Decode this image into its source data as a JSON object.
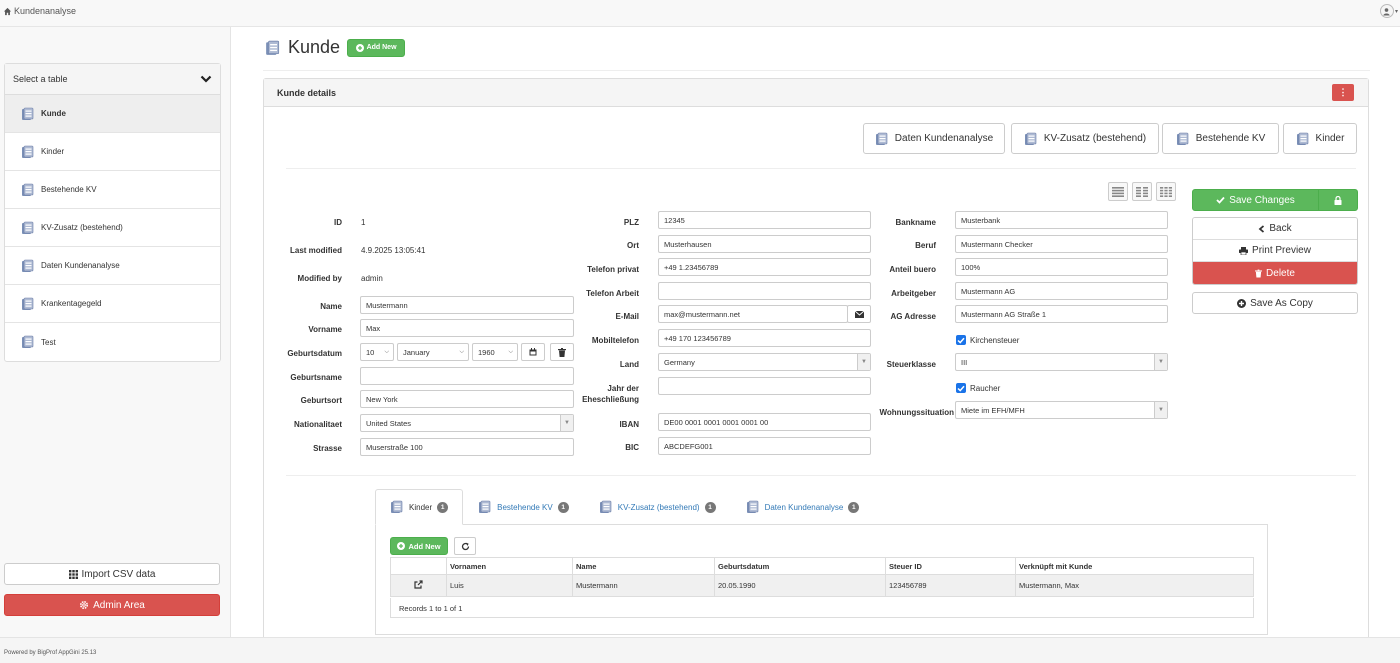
{
  "app": {
    "title": "Kundenanalyse"
  },
  "sidebar": {
    "select_label": "Select a table",
    "tables": [
      {
        "label": "Kunde",
        "active": true
      },
      {
        "label": "Kinder",
        "active": false
      },
      {
        "label": "Bestehende KV",
        "active": false
      },
      {
        "label": "KV-Zusatz (bestehend)",
        "active": false
      },
      {
        "label": "Daten Kundenanalyse",
        "active": false
      },
      {
        "label": "Krankentagegeld",
        "active": false
      },
      {
        "label": "Test",
        "active": false
      }
    ],
    "import_csv_label": "Import CSV data",
    "admin_label": "Admin Area"
  },
  "footer": {
    "text": "Powered by BigProf AppGini 25.13"
  },
  "page": {
    "title": "Kunde",
    "add_new_label": "Add New"
  },
  "details": {
    "title": "Kunde details",
    "kebab": "⋮",
    "link_buttons": [
      "Daten Kundenanalyse",
      "KV-Zusatz (bestehend)",
      "Bestehende KV",
      "Kinder"
    ]
  },
  "form": {
    "col1": {
      "id_label": "ID",
      "id_value": "1",
      "last_modified_label": "Last modified",
      "last_modified_value": "4.9.2025 13:05:41",
      "modified_by_label": "Modified by",
      "modified_by_value": "admin",
      "name_label": "Name",
      "name_value": "Mustermann",
      "vorname_label": "Vorname",
      "vorname_value": "Max",
      "geburtsdatum_label": "Geburtsdatum",
      "geburtsdatum_day": "10",
      "geburtsdatum_month": "January",
      "geburtsdatum_year": "1960",
      "geburtsname_label": "Geburtsname",
      "geburtsname_value": "",
      "geburtsort_label": "Geburtsort",
      "geburtsort_value": "New York",
      "nationalitaet_label": "Nationalitaet",
      "nationalitaet_value": "United States",
      "strasse_label": "Strasse",
      "strasse_value": "Muserstraße 100"
    },
    "col2": {
      "plz_label": "PLZ",
      "plz_value": "12345",
      "ort_label": "Ort",
      "ort_value": "Musterhausen",
      "telefon_privat_label": "Telefon privat",
      "telefon_privat_value": "+49 1.23456789",
      "telefon_arbeit_label": "Telefon Arbeit",
      "telefon_arbeit_value": "",
      "email_label": "E-Mail",
      "email_value": "max@mustermann.net",
      "mobiltelefon_label": "Mobiltelefon",
      "mobiltelefon_value": "+49 170 123456789",
      "land_label": "Land",
      "land_value": "Germany",
      "eheschliessung_label_1": "Jahr der",
      "eheschliessung_label_2": "Eheschließung",
      "eheschliessung_value": "",
      "iban_label": "IBAN",
      "iban_value": "DE00 0001 0001 0001 0001 00",
      "bic_label": "BIC",
      "bic_value": "ABCDEFG001"
    },
    "col3": {
      "bankname_label": "Bankname",
      "bankname_value": "Musterbank",
      "beruf_label": "Beruf",
      "beruf_value": "Mustermann Checker",
      "anteil_buero_label": "Anteil buero",
      "anteil_buero_value": "100%",
      "arbeitgeber_label": "Arbeitgeber",
      "arbeitgeber_value": "Mustermann AG",
      "ag_adresse_label": "AG Adresse",
      "ag_adresse_value": "Mustermann AG Straße 1",
      "kirchensteuer_label": "Kirchensteuer",
      "kirchensteuer_checked": true,
      "steuerklasse_label": "Steuerklasse",
      "steuerklasse_value": "III",
      "raucher_label": "Raucher",
      "raucher_checked": true,
      "wohnungssituation_label": "Wohnungssituation",
      "wohnungssituation_value": "Miete im EFH/MFH"
    }
  },
  "actions": {
    "save_label": "Save Changes",
    "back_label": "Back",
    "print_label": "Print Preview",
    "delete_label": "Delete",
    "copy_label": "Save As Copy"
  },
  "children": {
    "tabs": [
      {
        "label": "Kinder",
        "count": "1"
      },
      {
        "label": "Bestehende KV",
        "count": "1"
      },
      {
        "label": "KV-Zusatz (bestehend)",
        "count": "1"
      },
      {
        "label": "Daten Kundenanalyse",
        "count": "1"
      }
    ],
    "add_new_label": "Add New",
    "columns": [
      "Vornamen",
      "Name",
      "Geburtsdatum",
      "Steuer ID",
      "Verknüpft mit Kunde"
    ],
    "rows": [
      [
        "Luis",
        "Mustermann",
        "20.05.1990",
        "123456789",
        "Mustermann, Max"
      ]
    ],
    "records_text": "Records 1 to 1 of 1"
  },
  "colors": {
    "green": "#5cb85c",
    "red": "#d9534f",
    "link": "#337ab7",
    "checkbox": "#1a73e8"
  }
}
